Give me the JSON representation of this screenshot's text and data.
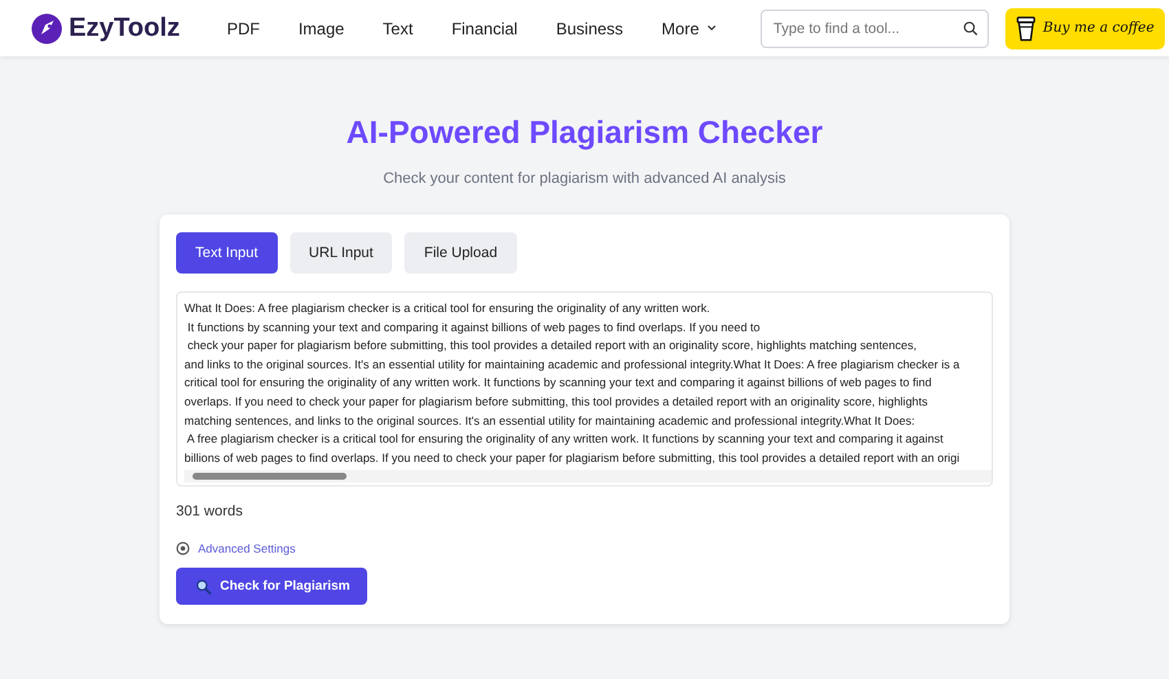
{
  "header": {
    "logo": "EzyToolz",
    "nav": [
      {
        "label": "PDF",
        "dropdown": false
      },
      {
        "label": "Image",
        "dropdown": false
      },
      {
        "label": "Text",
        "dropdown": false
      },
      {
        "label": "Financial",
        "dropdown": false
      },
      {
        "label": "Business",
        "dropdown": false
      },
      {
        "label": "More",
        "dropdown": true
      }
    ],
    "search": {
      "placeholder": "Type to find a tool..."
    },
    "coffee_button": "Buy me a coffee"
  },
  "title": "AI-Powered Plagiarism Checker",
  "subtitle": "Check your content for plagiarism with advanced AI analysis",
  "tabs": [
    {
      "label": "Text Input",
      "selected": true
    },
    {
      "label": "URL Input",
      "selected": false
    },
    {
      "label": "File Upload",
      "selected": false
    }
  ],
  "text_lines": [
    "What It Does: A free plagiarism checker is a critical tool for ensuring the originality of any written work.",
    " It functions by scanning your text and comparing it against billions of web pages to find overlaps. If you need to",
    " check your paper for plagiarism before submitting, this tool provides a detailed report with an originality score, highlights matching sentences,",
    "and links to the original sources. It's an essential utility for maintaining academic and professional integrity.What It Does: A free plagiarism checker is a",
    "critical tool for ensuring the originality of any written work. It functions by scanning your text and comparing it against billions of web pages to find",
    "overlaps. If you need to check your paper for plagiarism before submitting, this tool provides a detailed report with an originality score, highlights",
    "matching sentences, and links to the original sources. It's an essential utility for maintaining academic and professional integrity.What It Does:",
    " A free plagiarism checker is a critical tool for ensuring the originality of any written work. It functions by scanning your text and comparing it against",
    "billions of web pages to find overlaps. If you need to check your paper for plagiarism before submitting, this tool provides a detailed report with an origi"
  ],
  "word_count": "301 words",
  "advanced_settings": "Advanced Settings",
  "check_button": "Check for Plagiarism"
}
